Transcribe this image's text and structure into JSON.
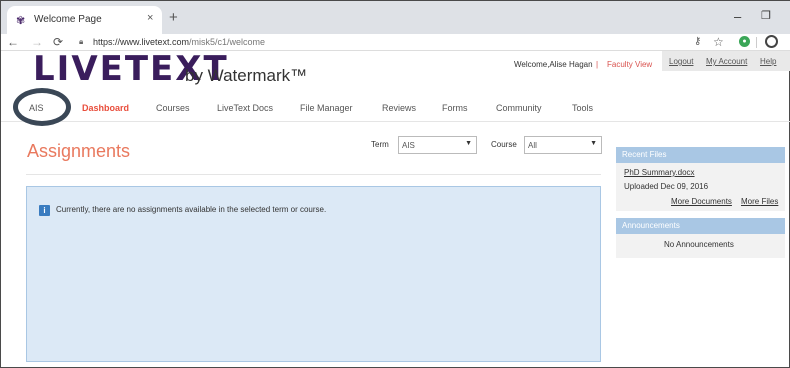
{
  "browser": {
    "tab_title": "Welcome Page",
    "tab_close": "×",
    "new_tab": "+",
    "minimize": "–",
    "maximize": "❐",
    "url_host": "https://www.livetext.com",
    "url_path": "/misk5/c1/welcome",
    "icons": [
      "favicon-icon",
      "back-icon",
      "forward-icon",
      "reload-icon",
      "lock-icon",
      "key-icon",
      "star-icon",
      "extension-icon",
      "profile-icon"
    ]
  },
  "header": {
    "logo": "LIVETEXT",
    "tagline": "by Watermark™",
    "welcome": "Welcome,Alise Hagan",
    "separator": "|",
    "faculty_view": "Faculty View",
    "links": [
      "Logout",
      "My Account",
      "Help"
    ]
  },
  "menu": {
    "items": [
      "AIS",
      "Dashboard",
      "Courses",
      "LiveText Docs",
      "File Manager",
      "Reviews",
      "Forms",
      "Community",
      "Tools"
    ],
    "active": "Dashboard"
  },
  "main": {
    "title": "Assignments",
    "term_label": "Term",
    "term_value": "AIS",
    "course_label": "Course",
    "course_value": "All",
    "info_message": "Currently, there are no assignments available in the selected term or course."
  },
  "sidebar": {
    "recent_files_title": "Recent Files",
    "file_name": "PhD Summary.docx",
    "uploaded": "Uploaded Dec 09, 2016",
    "more_documents": "More Documents",
    "more_files": "More Files",
    "announcements_title": "Announcements",
    "no_announcements": "No Announcements"
  },
  "colors": {
    "accent": "#e94e3c",
    "title": "#e9795e",
    "info_bg": "#dce9f6",
    "panel_head": "#a9c7e4",
    "logo": "#3a1d5c"
  }
}
